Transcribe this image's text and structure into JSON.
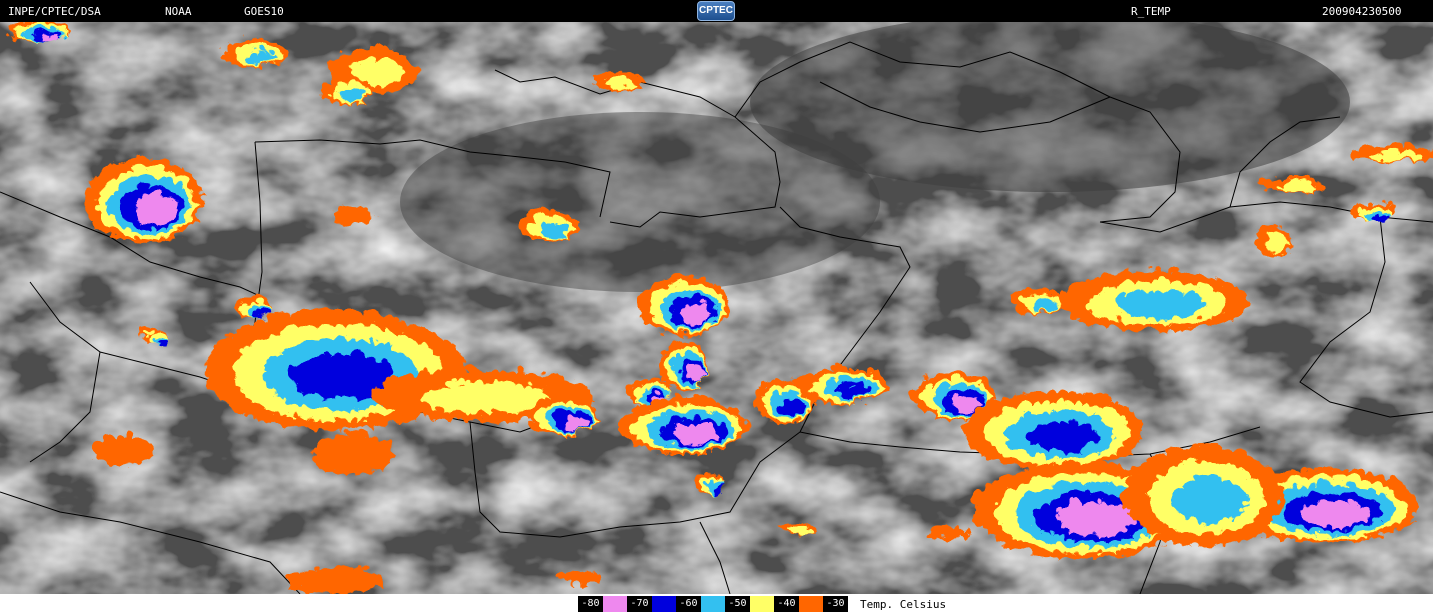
{
  "header": {
    "source": "INPE/CPTEC/DSA",
    "agency": "NOAA",
    "satellite": "GOES10",
    "logo_text": "CPTEC",
    "product": "R_TEMP",
    "timestamp": "200904230500"
  },
  "legend": {
    "entries": [
      {
        "label": "-80",
        "color": "#ee88ee"
      },
      {
        "label": "-70",
        "color": "#0000dd"
      },
      {
        "label": "-60",
        "color": "#33c0f0"
      },
      {
        "label": "-50",
        "color": "#ffff66"
      },
      {
        "label": "-40",
        "color": "#ff6600"
      },
      {
        "label": "-30",
        "color": "#ff6600"
      }
    ],
    "unit_label": "Temp. Celsius"
  },
  "colors": {
    "background_cloud": "#5a5a5a",
    "border_lines": "#000000",
    "header_bg": "#000000",
    "header_text": "#ffffff"
  }
}
